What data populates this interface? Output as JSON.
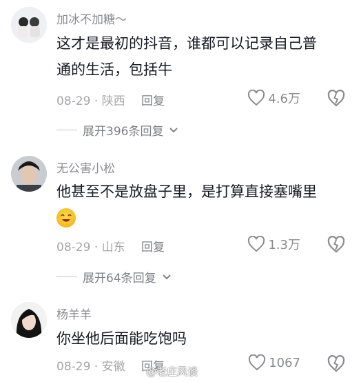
{
  "comments": [
    {
      "username": "加冰不加糖～",
      "lines": [
        "这才是最初的抖音，谁都可以记录自己普",
        "通的生活，包括牛"
      ],
      "date": "08-29",
      "location": "陕西",
      "reply_label": "回复",
      "likes": "4.6万",
      "expand_label": "展开396条回复"
    },
    {
      "username": "无公害小松",
      "lines": [
        "他甚至不是放盘子里，是打算直接塞嘴里"
      ],
      "emoji": "smiling-face-emoji",
      "date": "08-29",
      "location": "山东",
      "reply_label": "回复",
      "likes": "1.3万",
      "expand_label": "展开64条回复"
    },
    {
      "username": "杨羊羊",
      "lines": [
        "你坐他后面能吃饱吗"
      ],
      "date": "08-29",
      "location": "安徽",
      "reply_label": "回复",
      "likes": "1067"
    }
  ],
  "watermark": "@老庄风谈",
  "icons": {
    "like": "heart-icon",
    "dislike": "broken-heart-icon",
    "expand": "chevron-down-icon"
  }
}
